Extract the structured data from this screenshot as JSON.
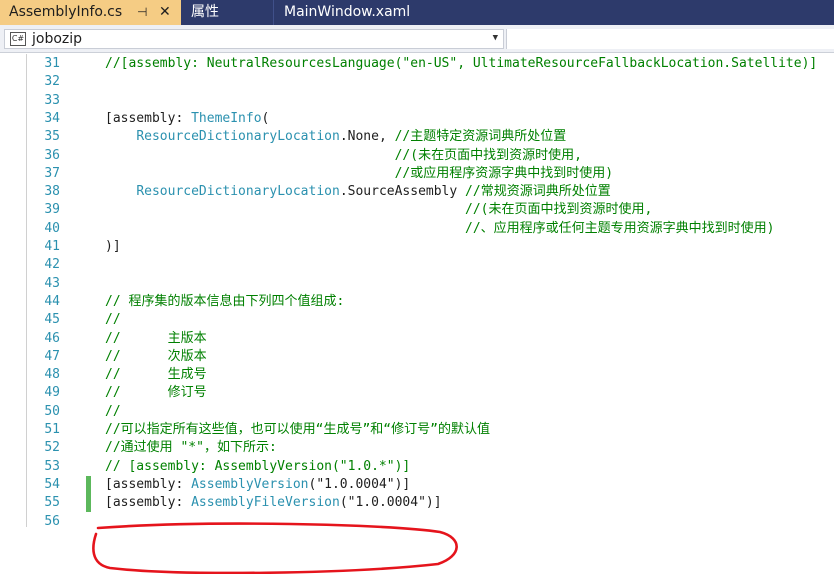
{
  "tabs": [
    {
      "label": "AssemblyInfo.cs",
      "pin": "⊣",
      "close": "✕",
      "active": true
    },
    {
      "label": "属性",
      "active": false
    },
    {
      "label": "MainWindow.xaml",
      "active": false
    }
  ],
  "navbar": {
    "project_icon": "C#",
    "project": "jobozip"
  },
  "lines": [
    {
      "n": "31",
      "segs": [
        {
          "t": "//[assembly: NeutralResourcesLanguage(\"en-US\", UltimateResourceFallbackLocation.Satellite)]",
          "c": "cm"
        }
      ]
    },
    {
      "n": "32",
      "segs": []
    },
    {
      "n": "33",
      "segs": []
    },
    {
      "n": "34",
      "segs": [
        {
          "t": "[assembly: ",
          "c": ""
        },
        {
          "t": "ThemeInfo",
          "c": "ty"
        },
        {
          "t": "(",
          "c": ""
        }
      ]
    },
    {
      "n": "35",
      "segs": [
        {
          "t": "    ",
          "c": ""
        },
        {
          "t": "ResourceDictionaryLocation",
          "c": "ty"
        },
        {
          "t": ".None, ",
          "c": ""
        },
        {
          "t": "//主题特定资源词典所处位置",
          "c": "cm"
        }
      ]
    },
    {
      "n": "36",
      "segs": [
        {
          "t": "                                     ",
          "c": ""
        },
        {
          "t": "//(未在页面中找到资源时使用,",
          "c": "cm"
        }
      ]
    },
    {
      "n": "37",
      "segs": [
        {
          "t": "                                     ",
          "c": ""
        },
        {
          "t": "//或应用程序资源字典中找到时使用)",
          "c": "cm"
        }
      ]
    },
    {
      "n": "38",
      "segs": [
        {
          "t": "    ",
          "c": ""
        },
        {
          "t": "ResourceDictionaryLocation",
          "c": "ty"
        },
        {
          "t": ".SourceAssembly ",
          "c": ""
        },
        {
          "t": "//常规资源词典所处位置",
          "c": "cm"
        }
      ]
    },
    {
      "n": "39",
      "segs": [
        {
          "t": "                                              ",
          "c": ""
        },
        {
          "t": "//(未在页面中找到资源时使用,",
          "c": "cm"
        }
      ]
    },
    {
      "n": "40",
      "segs": [
        {
          "t": "                                              ",
          "c": ""
        },
        {
          "t": "//、应用程序或任何主题专用资源字典中找到时使用)",
          "c": "cm"
        }
      ]
    },
    {
      "n": "41",
      "segs": [
        {
          "t": ")]",
          "c": ""
        }
      ]
    },
    {
      "n": "42",
      "segs": []
    },
    {
      "n": "43",
      "segs": []
    },
    {
      "n": "44",
      "segs": [
        {
          "t": "// 程序集的版本信息由下列四个值组成:",
          "c": "cm"
        }
      ]
    },
    {
      "n": "45",
      "segs": [
        {
          "t": "//",
          "c": "cm"
        }
      ]
    },
    {
      "n": "46",
      "segs": [
        {
          "t": "//      主版本",
          "c": "cm"
        }
      ]
    },
    {
      "n": "47",
      "segs": [
        {
          "t": "//      次版本",
          "c": "cm"
        }
      ]
    },
    {
      "n": "48",
      "segs": [
        {
          "t": "//      生成号",
          "c": "cm"
        }
      ]
    },
    {
      "n": "49",
      "segs": [
        {
          "t": "//      修订号",
          "c": "cm"
        }
      ]
    },
    {
      "n": "50",
      "segs": [
        {
          "t": "//",
          "c": "cm"
        }
      ]
    },
    {
      "n": "51",
      "segs": [
        {
          "t": "//可以指定所有这些值，也可以使用“生成号”和“修订号”的默认值",
          "c": "cm"
        }
      ]
    },
    {
      "n": "52",
      "segs": [
        {
          "t": "//通过使用 \"*\"，如下所示:",
          "c": "cm"
        }
      ]
    },
    {
      "n": "53",
      "segs": [
        {
          "t": "// [assembly: AssemblyVersion(\"1.0.*\")]",
          "c": "cm"
        }
      ]
    },
    {
      "n": "54",
      "segs": [
        {
          "t": "[assembly: ",
          "c": ""
        },
        {
          "t": "AssemblyVersion",
          "c": "ty"
        },
        {
          "t": "(\"1.0.0004\")]",
          "c": ""
        }
      ],
      "changed": true
    },
    {
      "n": "55",
      "segs": [
        {
          "t": "[assembly: ",
          "c": ""
        },
        {
          "t": "AssemblyFileVersion",
          "c": "ty"
        },
        {
          "t": "(\"1.0.0004\")]",
          "c": ""
        }
      ],
      "changed": true
    },
    {
      "n": "56",
      "segs": []
    }
  ],
  "highlight_color": "#e5141c",
  "colors": {
    "tabbar": "#2d3a6b",
    "active_tab": "#f5cc84",
    "line_number": "#2b91af",
    "comment": "#008000",
    "type": "#2b91af",
    "change_marker": "#5cb85c"
  }
}
